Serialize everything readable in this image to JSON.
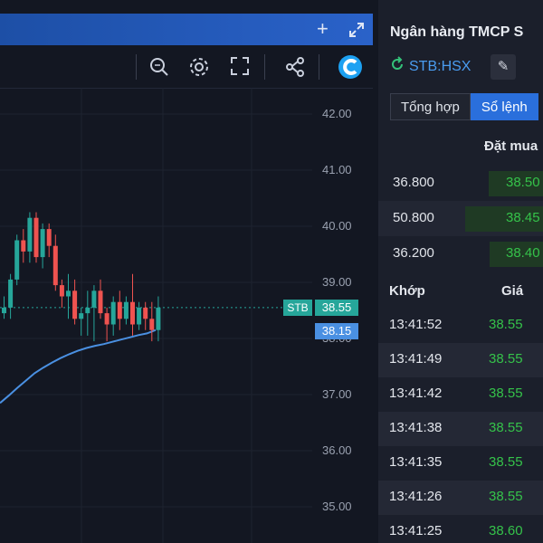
{
  "chart": {
    "price_axis": [
      "42.00",
      "41.00",
      "40.00",
      "39.00",
      "38.00",
      "37.00",
      "36.00",
      "35.00"
    ],
    "symbol_tag": "STB",
    "last_price_tag": "38.55",
    "ma_value_tag": "38.15",
    "header_icons": [
      "plus-icon",
      "expand-icon"
    ],
    "toolbar_icons": [
      "zoom-icon",
      "gear-icon",
      "fullscreen-icon",
      "share-icon",
      "logo-icon"
    ],
    "colors": {
      "up": "#26a69a",
      "down": "#ef5350",
      "ma": "#4a90e2",
      "header": "#2456b8"
    }
  },
  "chart_data": {
    "type": "candlestick",
    "ylim": [
      34.8,
      42.3
    ],
    "candles": [
      {
        "o": 38.45,
        "h": 38.75,
        "l": 38.35,
        "c": 38.55
      },
      {
        "o": 38.55,
        "h": 39.15,
        "l": 38.35,
        "c": 39.05
      },
      {
        "o": 39.05,
        "h": 39.85,
        "l": 38.95,
        "c": 39.75
      },
      {
        "o": 39.75,
        "h": 39.95,
        "l": 39.35,
        "c": 39.55
      },
      {
        "o": 39.55,
        "h": 40.25,
        "l": 39.35,
        "c": 40.15
      },
      {
        "o": 40.15,
        "h": 40.25,
        "l": 39.35,
        "c": 39.45
      },
      {
        "o": 39.45,
        "h": 40.05,
        "l": 39.25,
        "c": 39.95
      },
      {
        "o": 39.95,
        "h": 40.05,
        "l": 39.45,
        "c": 39.65
      },
      {
        "o": 39.65,
        "h": 39.85,
        "l": 38.85,
        "c": 38.95
      },
      {
        "o": 38.95,
        "h": 39.05,
        "l": 38.55,
        "c": 38.75
      },
      {
        "o": 38.75,
        "h": 39.15,
        "l": 38.35,
        "c": 38.85
      },
      {
        "o": 38.85,
        "h": 39.05,
        "l": 38.25,
        "c": 38.35
      },
      {
        "o": 38.35,
        "h": 38.55,
        "l": 38.05,
        "c": 38.45
      },
      {
        "o": 38.45,
        "h": 38.85,
        "l": 38.05,
        "c": 38.55
      },
      {
        "o": 38.55,
        "h": 38.95,
        "l": 37.95,
        "c": 38.85
      },
      {
        "o": 38.85,
        "h": 39.05,
        "l": 38.35,
        "c": 38.45
      },
      {
        "o": 38.45,
        "h": 38.55,
        "l": 37.95,
        "c": 38.25
      },
      {
        "o": 38.25,
        "h": 38.75,
        "l": 38.05,
        "c": 38.65
      },
      {
        "o": 38.65,
        "h": 38.85,
        "l": 38.15,
        "c": 38.35
      },
      {
        "o": 38.35,
        "h": 38.75,
        "l": 38.25,
        "c": 38.65
      },
      {
        "o": 38.65,
        "h": 39.15,
        "l": 38.05,
        "c": 38.25
      },
      {
        "o": 38.25,
        "h": 38.65,
        "l": 38.15,
        "c": 38.55
      },
      {
        "o": 38.55,
        "h": 38.65,
        "l": 38.15,
        "c": 38.35
      },
      {
        "o": 38.35,
        "h": 38.65,
        "l": 37.95,
        "c": 38.15
      },
      {
        "o": 38.15,
        "h": 38.75,
        "l": 37.95,
        "c": 38.55
      }
    ],
    "ma_line": [
      36.85,
      36.98,
      37.12,
      37.25,
      37.38,
      37.48,
      37.57,
      37.65,
      37.72,
      37.78,
      37.83,
      37.87,
      37.9,
      37.94,
      37.98,
      38.02,
      38.06,
      38.09,
      38.15
    ]
  },
  "panel": {
    "title": "Ngân hàng TMCP S",
    "ticker": "STB:HSX",
    "tabs": [
      "Tổng hợp",
      "Sổ lệnh"
    ],
    "active_tab": "Sổ lệnh",
    "orders_header": "Đặt mua",
    "orders": [
      {
        "qty": "36.800",
        "price": "38.50"
      },
      {
        "qty": "50.800",
        "price": "38.45"
      },
      {
        "qty": "36.200",
        "price": "38.40"
      }
    ],
    "trades_header": {
      "time": "Khớp",
      "price": "Giá"
    },
    "trades": [
      {
        "time": "13:41:52",
        "price": "38.55"
      },
      {
        "time": "13:41:49",
        "price": "38.55"
      },
      {
        "time": "13:41:42",
        "price": "38.55"
      },
      {
        "time": "13:41:38",
        "price": "38.55"
      },
      {
        "time": "13:41:35",
        "price": "38.55"
      },
      {
        "time": "13:41:26",
        "price": "38.55"
      },
      {
        "time": "13:41:25",
        "price": "38.60"
      }
    ]
  }
}
